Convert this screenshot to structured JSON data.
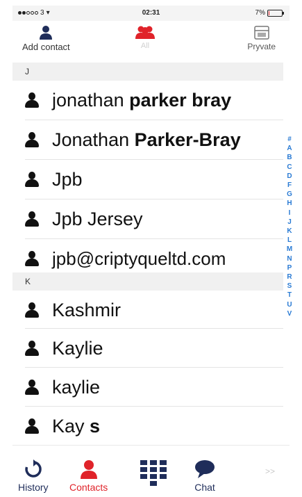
{
  "status_bar": {
    "carrier": "3",
    "time": "02:31",
    "battery": "7%",
    "battery_level": 0.07
  },
  "top_bar": {
    "add_contact_label": "Add contact",
    "all_label": "All",
    "pryvate_label": "Pryvate"
  },
  "sections": [
    {
      "letter": "J",
      "contacts": [
        {
          "first": "jonathan ",
          "rest": "parker bray"
        },
        {
          "first": "Jonathan ",
          "rest": "Parker-Bray"
        },
        {
          "first": "Jpb",
          "rest": ""
        },
        {
          "first": "Jpb Jersey",
          "rest": ""
        },
        {
          "first": "jpb@criptyqueltd.com",
          "rest": ""
        }
      ]
    },
    {
      "letter": "K",
      "contacts": [
        {
          "first": "Kashmir",
          "rest": ""
        },
        {
          "first": "Kaylie",
          "rest": ""
        },
        {
          "first": "kaylie",
          "rest": ""
        },
        {
          "first": "Kay ",
          "rest": "s"
        }
      ]
    }
  ],
  "index_letters": [
    "#",
    "A",
    "B",
    "C",
    "D",
    "F",
    "G",
    "H",
    "I",
    "J",
    "K",
    "L",
    "M",
    "N",
    "P",
    "R",
    "S",
    "T",
    "U",
    "V"
  ],
  "tab_bar": {
    "history_label": "History",
    "contacts_label": "Contacts",
    "chat_label": "Chat",
    "more_label": ">>"
  },
  "colors": {
    "accent_red": "#e0232a",
    "navy": "#1f2d5a",
    "index_blue": "#2a7bd4"
  },
  "icons": [
    "wifi-icon",
    "battery-icon",
    "add-contact-icon",
    "all-contacts-icon",
    "pryvate-icon",
    "person-icon",
    "history-icon",
    "contacts-icon",
    "keypad-icon",
    "chat-icon"
  ]
}
